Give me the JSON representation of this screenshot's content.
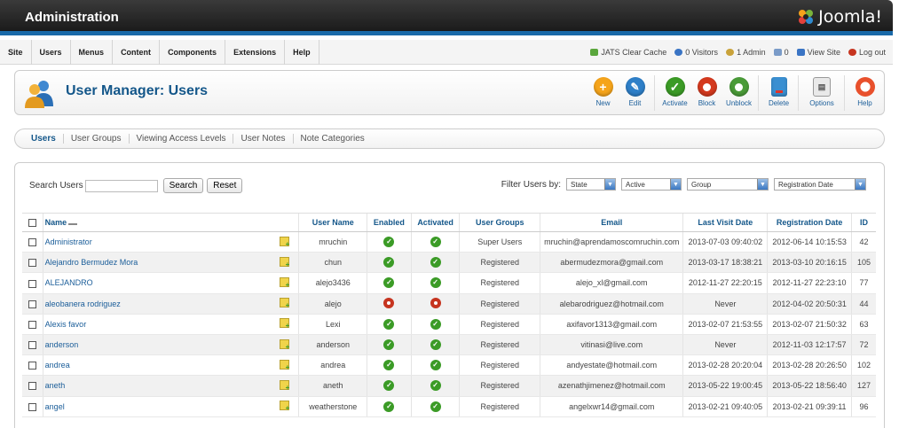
{
  "header": {
    "title": "Administration",
    "logo_text": "Joomla!"
  },
  "menu": [
    "Site",
    "Users",
    "Menus",
    "Content",
    "Components",
    "Extensions",
    "Help"
  ],
  "status": {
    "items": [
      "JATS Clear Cache",
      "0 Visitors",
      "1 Admin",
      "0",
      "View Site",
      "Log out"
    ],
    "colors": [
      "#5aa63c",
      "#3a74c4",
      "#c9a23a",
      "#7a9bc8",
      "#3a74c4",
      "#c6341f"
    ]
  },
  "page": {
    "title": "User Manager: Users"
  },
  "toolbar": [
    {
      "label": "New",
      "icon": "plus-icon",
      "color": "#f5a41b",
      "glyph": "+"
    },
    {
      "label": "Edit",
      "icon": "pencil-icon",
      "color": "#2e7fc8",
      "glyph": "✎"
    },
    {
      "label": "Activate",
      "icon": "check-icon",
      "color": "#3b9b26",
      "glyph": "✓"
    },
    {
      "label": "Block",
      "icon": "block-icon",
      "color": "#d4391e",
      "glyph": "●"
    },
    {
      "label": "Unblock",
      "icon": "unblock-icon",
      "color": "#4a9b38",
      "glyph": "●"
    },
    {
      "label": "Delete",
      "icon": "trash-icon",
      "color": "#3a8fd1",
      "glyph": "🗑"
    }
  ],
  "toolbar_extra": [
    {
      "label": "Options",
      "icon": "options-icon"
    },
    {
      "label": "Help",
      "icon": "help-icon"
    }
  ],
  "subnav": [
    "Users",
    "User Groups",
    "Viewing Access Levels",
    "User Notes",
    "Note Categories"
  ],
  "search": {
    "label": "Search Users",
    "search_btn": "Search",
    "reset_btn": "Reset"
  },
  "filter": {
    "label": "Filter Users by:",
    "state": "State",
    "active": "Active",
    "group": "Group",
    "regdate": "Registration Date"
  },
  "columns": [
    "Name",
    "User Name",
    "Enabled",
    "Activated",
    "User Groups",
    "Email",
    "Last Visit Date",
    "Registration Date",
    "ID"
  ],
  "rows": [
    {
      "name": "Administrator",
      "username": "mruchin",
      "enabled": true,
      "activated": true,
      "group": "Super Users",
      "email": "mruchin@aprendamoscomruchin.com",
      "last": "2013-07-03 09:40:02",
      "reg": "2012-06-14 10:15:53",
      "id": "42"
    },
    {
      "name": "Alejandro Bermudez Mora",
      "username": "chun",
      "enabled": true,
      "activated": true,
      "group": "Registered",
      "email": "abermudezmora@gmail.com",
      "last": "2013-03-17 18:38:21",
      "reg": "2013-03-10 20:16:15",
      "id": "105"
    },
    {
      "name": "ALEJANDRO",
      "username": "alejo3436",
      "enabled": true,
      "activated": true,
      "group": "Registered",
      "email": "alejo_xl@gmail.com",
      "last": "2012-11-27 22:20:15",
      "reg": "2012-11-27 22:23:10",
      "id": "77"
    },
    {
      "name": "aleobanera rodriguez",
      "username": "alejo",
      "enabled": false,
      "activated": false,
      "group": "Registered",
      "email": "alebarodriguez@hotmail.com",
      "last": "Never",
      "reg": "2012-04-02 20:50:31",
      "id": "44"
    },
    {
      "name": "Alexis favor",
      "username": "Lexi",
      "enabled": true,
      "activated": true,
      "group": "Registered",
      "email": "axifavor1313@gmail.com",
      "last": "2013-02-07 21:53:55",
      "reg": "2013-02-07 21:50:32",
      "id": "63"
    },
    {
      "name": "anderson",
      "username": "anderson",
      "enabled": true,
      "activated": true,
      "group": "Registered",
      "email": "vitinasi@live.com",
      "last": "Never",
      "reg": "2012-11-03 12:17:57",
      "id": "72"
    },
    {
      "name": "andrea",
      "username": "andrea",
      "enabled": true,
      "activated": true,
      "group": "Registered",
      "email": "andyestate@hotmail.com",
      "last": "2013-02-28 20:20:04",
      "reg": "2013-02-28 20:26:50",
      "id": "102"
    },
    {
      "name": "aneth",
      "username": "aneth",
      "enabled": true,
      "activated": true,
      "group": "Registered",
      "email": "azenathjimenez@hotmail.com",
      "last": "2013-05-22 19:00:45",
      "reg": "2013-05-22 18:56:40",
      "id": "127"
    },
    {
      "name": "angel",
      "username": "weatherstone",
      "enabled": true,
      "activated": true,
      "group": "Registered",
      "email": "angelxwr14@gmail.com",
      "last": "2013-02-21 09:40:05",
      "reg": "2013-02-21 09:39:11",
      "id": "96"
    }
  ]
}
